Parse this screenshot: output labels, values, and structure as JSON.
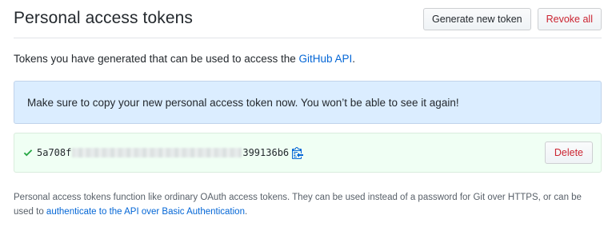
{
  "header": {
    "title": "Personal access tokens",
    "generate_label": "Generate new token",
    "revoke_all_label": "Revoke all"
  },
  "description": {
    "text_before": "Tokens you have generated that can be used to access the ",
    "link_text": "GitHub API",
    "text_after": "."
  },
  "flash": {
    "message": "Make sure to copy your new personal access token now. You won’t be able to see it again!"
  },
  "token": {
    "prefix": "5a708f",
    "suffix": "399136b6",
    "delete_label": "Delete",
    "check_icon": "check-icon",
    "copy_icon": "clippy-icon"
  },
  "note": {
    "text_before": "Personal access tokens function like ordinary OAuth access tokens. They can be used instead of a password for Git over HTTPS, or can be used to ",
    "link_text": "authenticate to the API over Basic Authentication",
    "text_after": "."
  },
  "colors": {
    "link": "#0366d6",
    "flash_bg": "#dbedff",
    "token_bg": "#f0fff4",
    "check": "#28a745",
    "danger": "#cb2431"
  }
}
